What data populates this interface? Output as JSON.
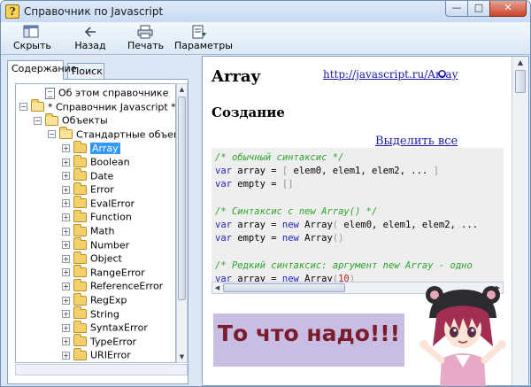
{
  "window": {
    "title": "Справочник по Javascript",
    "icon_glyph": "?",
    "controls": {
      "minimize": "—",
      "maximize": "□",
      "close": "✕"
    }
  },
  "toolbar": {
    "hide_label": "Скрыть",
    "back_label": "Назад",
    "print_label": "Печать",
    "params_label": "Параметры",
    "icons": {
      "hide": "hide-pane-icon",
      "back": "back-arrow-icon",
      "print": "printer-icon",
      "params": "options-icon"
    }
  },
  "left_pane": {
    "tabs": [
      {
        "label": "Содержание",
        "active": true
      },
      {
        "label": "Поиск",
        "active": false
      }
    ],
    "tree": [
      {
        "label": "Об этом справочнике",
        "icon": "doc",
        "level": 1,
        "expander": ""
      },
      {
        "label": "* Справочник Javascript *",
        "icon": "folder-open",
        "level": 0,
        "expander": "−"
      },
      {
        "label": "Объекты",
        "icon": "folder-open",
        "level": 1,
        "expander": "−"
      },
      {
        "label": "Стандартные объекты",
        "icon": "folder-open",
        "level": 2,
        "expander": "−"
      },
      {
        "label": "Array",
        "icon": "folder",
        "level": 3,
        "expander": "+",
        "selected": true
      },
      {
        "label": "Boolean",
        "icon": "folder",
        "level": 3,
        "expander": "+"
      },
      {
        "label": "Date",
        "icon": "folder",
        "level": 3,
        "expander": "+"
      },
      {
        "label": "Error",
        "icon": "folder",
        "level": 3,
        "expander": "+"
      },
      {
        "label": "EvalError",
        "icon": "folder",
        "level": 3,
        "expander": "+"
      },
      {
        "label": "Function",
        "icon": "folder",
        "level": 3,
        "expander": "+"
      },
      {
        "label": "Math",
        "icon": "folder",
        "level": 3,
        "expander": "+"
      },
      {
        "label": "Number",
        "icon": "folder",
        "level": 3,
        "expander": "+"
      },
      {
        "label": "Object",
        "icon": "folder",
        "level": 3,
        "expander": "+"
      },
      {
        "label": "RangeError",
        "icon": "folder",
        "level": 3,
        "expander": "+"
      },
      {
        "label": "ReferenceError",
        "icon": "folder",
        "level": 3,
        "expander": "+"
      },
      {
        "label": "RegExp",
        "icon": "folder",
        "level": 3,
        "expander": "+"
      },
      {
        "label": "String",
        "icon": "folder",
        "level": 3,
        "expander": "+"
      },
      {
        "label": "SyntaxError",
        "icon": "folder",
        "level": 3,
        "expander": "+"
      },
      {
        "label": "TypeError",
        "icon": "folder",
        "level": 3,
        "expander": "+"
      },
      {
        "label": "URIError",
        "icon": "folder",
        "level": 3,
        "expander": "+"
      }
    ]
  },
  "content": {
    "title": "Array",
    "link": "http://javascript.ru/Array",
    "section_title": "Создание",
    "select_all": "Выделить все",
    "code_lines": [
      [
        {
          "t": "/* обычный синтаксис */",
          "c": "comment"
        }
      ],
      [
        {
          "t": "var",
          "c": "kw"
        },
        {
          "t": " array = ",
          "c": "txt"
        },
        {
          "t": "[",
          "c": "pun"
        },
        {
          "t": " elem0, elem1, elem2, ... ",
          "c": "txt"
        },
        {
          "t": "]",
          "c": "pun"
        }
      ],
      [
        {
          "t": "var",
          "c": "kw"
        },
        {
          "t": " empty = ",
          "c": "txt"
        },
        {
          "t": "[]",
          "c": "pun"
        }
      ],
      [
        {
          "t": "",
          "c": "txt"
        }
      ],
      [
        {
          "t": "/* Синтаксис с new Array() */",
          "c": "comment"
        }
      ],
      [
        {
          "t": "var",
          "c": "kw"
        },
        {
          "t": " array = ",
          "c": "txt"
        },
        {
          "t": "new",
          "c": "kw"
        },
        {
          "t": " Array",
          "c": "txt"
        },
        {
          "t": "(",
          "c": "pun"
        },
        {
          "t": " elem0, elem1, elem2, ...",
          "c": "txt"
        }
      ],
      [
        {
          "t": "var",
          "c": "kw"
        },
        {
          "t": " empty = ",
          "c": "txt"
        },
        {
          "t": "new",
          "c": "kw"
        },
        {
          "t": " Array",
          "c": "txt"
        },
        {
          "t": "()",
          "c": "pun"
        }
      ],
      [
        {
          "t": "",
          "c": "txt"
        }
      ],
      [
        {
          "t": "/* Редкий синтаксис: аргумент new Array - одно",
          "c": "comment"
        }
      ],
      [
        {
          "t": "var",
          "c": "kw"
        },
        {
          "t": " array = ",
          "c": "txt"
        },
        {
          "t": "new",
          "c": "kw"
        },
        {
          "t": " Array",
          "c": "txt"
        },
        {
          "t": "(",
          "c": "pun"
        },
        {
          "t": "10",
          "c": "num"
        },
        {
          "t": ")",
          "c": "pun"
        }
      ]
    ]
  },
  "overlay": {
    "caption": "То что надо!!!",
    "caption_color": "#7a1d2b",
    "caption_bg": "#c9bde4",
    "character": "anime-girl-illustration"
  },
  "colors": {
    "link": "#1a1aa6",
    "keyword": "#1f1fc0",
    "comment": "#2aa52a",
    "number": "#c02020",
    "selection": "#3399ff"
  }
}
